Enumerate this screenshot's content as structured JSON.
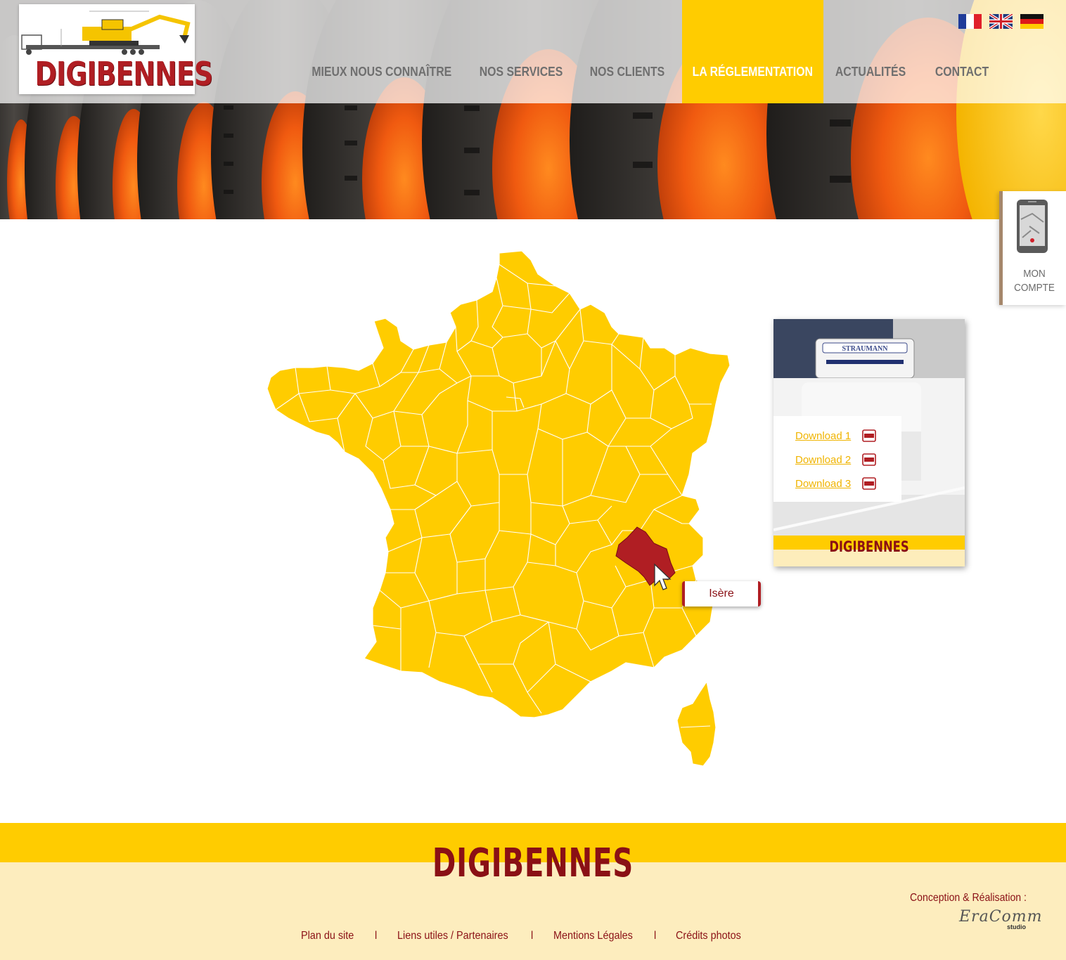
{
  "colors": {
    "accent_yellow": "#ffcc00",
    "brand_red": "#8a1015",
    "highlight_red": "#b01e23",
    "footer_cream": "#fdedbe",
    "nav_text": "#6f6f6f"
  },
  "header": {
    "logo_text": "DIGIBENNES",
    "nav": [
      {
        "label": "MIEUX NOUS CONNAÎTRE",
        "active": false
      },
      {
        "label": "NOS SERVICES",
        "active": false
      },
      {
        "label": "NOS CLIENTS",
        "active": false
      },
      {
        "label": "LA RÉGLEMENTATION",
        "active": true
      },
      {
        "label": "ACTUALITÉS",
        "active": false
      },
      {
        "label": "CONTACT",
        "active": false
      }
    ],
    "languages": [
      {
        "icon": "flag-france-icon"
      },
      {
        "icon": "flag-uk-icon"
      },
      {
        "icon": "flag-germany-icon"
      }
    ]
  },
  "account": {
    "icon": "phone-map-icon",
    "label_line1": "MON",
    "label_line2": "COMPTE"
  },
  "map": {
    "hovered_region": "Isère",
    "tooltip": "Isère",
    "fill_color": "#ffcc00",
    "hover_color": "#b01e23"
  },
  "downloads": {
    "items": [
      {
        "label": "Download 1",
        "icon": "pdf-icon"
      },
      {
        "label": "Download 2",
        "icon": "pdf-icon"
      },
      {
        "label": "Download 3",
        "icon": "pdf-icon"
      }
    ],
    "truck_text": "STRAUMANN",
    "brand": "DIGIBENNES"
  },
  "footer": {
    "brand": "DIGIBENNES",
    "links": [
      "Plan du site",
      "Liens utiles / Partenaires",
      "Mentions Légales",
      "Crédits photos"
    ],
    "separator": "l",
    "credit_label": "Conception & Réalisation :",
    "studio_name": "EraComm",
    "studio_sub": "studio"
  }
}
